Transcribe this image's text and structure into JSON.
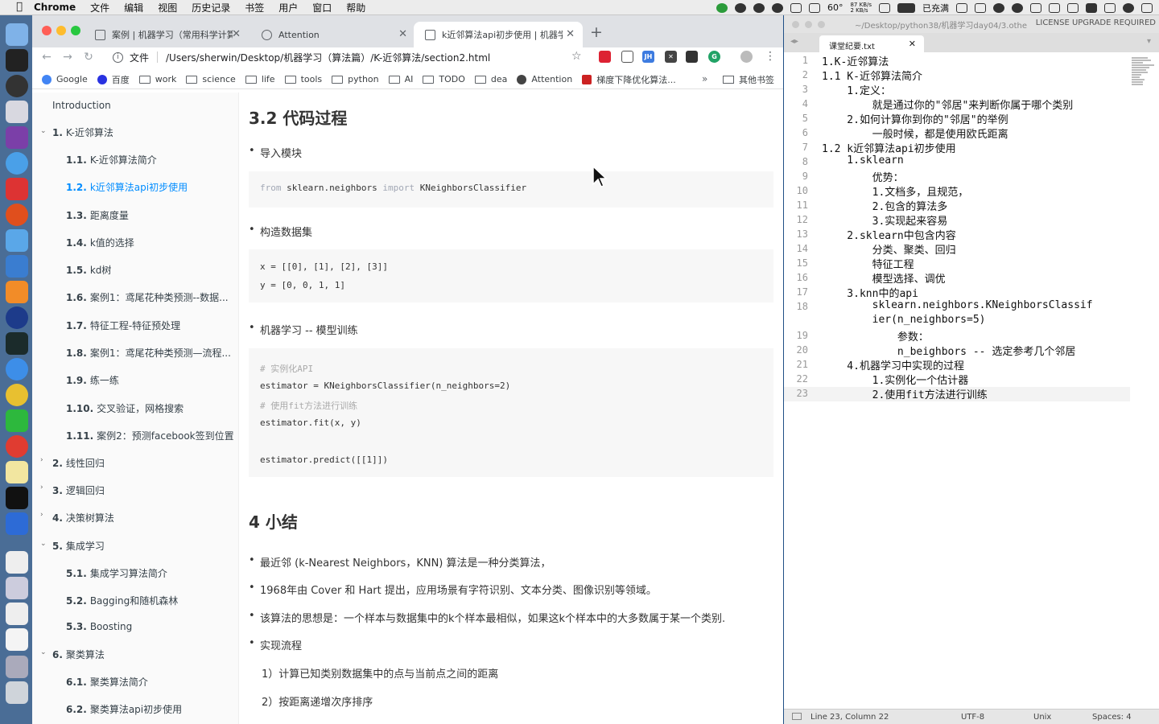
{
  "menubar": {
    "app": "Chrome",
    "items": [
      "文件",
      "编辑",
      "视图",
      "历史记录",
      "书签",
      "用户",
      "窗口",
      "帮助"
    ],
    "battery": "60°",
    "network": "87 KB/s\n2 KB/s",
    "charging": "已充满"
  },
  "chrome": {
    "tabs": [
      {
        "title": "案例 | 机器学习（常用科学计算",
        "active": false
      },
      {
        "title": "Attention",
        "active": false
      },
      {
        "title": "k近邻算法api初步使用 | 机器学",
        "active": true
      }
    ],
    "omnibox": {
      "scheme": "文件",
      "url": "/Users/sherwin/Desktop/机器学习（算法篇）/K-近邻算法/section2.html"
    },
    "bookmarks": [
      "Google",
      "百度",
      "work",
      "science",
      "life",
      "tools",
      "python",
      "AI",
      "TODO",
      "dea",
      "Attention",
      "梯度下降优化算法..."
    ],
    "bookmarks_more": "»",
    "bookmarks_other": "其他书签"
  },
  "sidebar": {
    "intro": "Introduction",
    "items": [
      {
        "num": "1.",
        "label": "K-近邻算法",
        "level": 1
      },
      {
        "num": "1.1.",
        "label": "K-近邻算法简介",
        "level": 2
      },
      {
        "num": "1.2.",
        "label": "k近邻算法api初步使用",
        "level": 2,
        "active": true
      },
      {
        "num": "1.3.",
        "label": "距离度量",
        "level": 2
      },
      {
        "num": "1.4.",
        "label": "k值的选择",
        "level": 2
      },
      {
        "num": "1.5.",
        "label": "kd树",
        "level": 2
      },
      {
        "num": "1.6.",
        "label": "案例1：鸢尾花种类预测--数据...",
        "level": 2
      },
      {
        "num": "1.7.",
        "label": "特征工程-特征预处理",
        "level": 2
      },
      {
        "num": "1.8.",
        "label": "案例1：鸢尾花种类预测—流程...",
        "level": 2
      },
      {
        "num": "1.9.",
        "label": "练一练",
        "level": 2
      },
      {
        "num": "1.10.",
        "label": "交叉验证，网格搜索",
        "level": 2
      },
      {
        "num": "1.11.",
        "label": "案例2：预测facebook签到位置",
        "level": 2
      },
      {
        "num": "2.",
        "label": "线性回归",
        "level": 1
      },
      {
        "num": "3.",
        "label": "逻辑回归",
        "level": 1
      },
      {
        "num": "4.",
        "label": "决策树算法",
        "level": 1
      },
      {
        "num": "5.",
        "label": "集成学习",
        "level": 1
      },
      {
        "num": "5.1.",
        "label": "集成学习算法简介",
        "level": 2
      },
      {
        "num": "5.2.",
        "label": "Bagging和随机森林",
        "level": 2
      },
      {
        "num": "5.3.",
        "label": "Boosting",
        "level": 2
      },
      {
        "num": "6.",
        "label": "聚类算法",
        "level": 1
      },
      {
        "num": "6.1.",
        "label": "聚类算法简介",
        "level": 2
      },
      {
        "num": "6.2.",
        "label": "聚类算法api初步使用",
        "level": 2
      }
    ]
  },
  "content": {
    "h_code": "3.2 代码过程",
    "b1": "导入模块",
    "code1_from": "from",
    "code1_mod": " sklearn.neighbors ",
    "code1_import": "import",
    "code1_cls": " KNeighborsClassifier",
    "b2": "构造数据集",
    "code2_l1": "x = [[0], [1], [2], [3]]",
    "code2_l2": "y = [0, 0, 1, 1]",
    "b3": "机器学习 -- 模型训练",
    "code3_c1": "# 实例化API",
    "code3_l2": "estimator = KNeighborsClassifier(n_neighbors=2)",
    "code3_c2": "# 使用fit方法进行训练",
    "code3_l4": "estimator.fit(x, y)",
    "code3_l6": "estimator.predict([[1]])",
    "h_summary": "4 小结",
    "s1": "最近邻 (k-Nearest Neighbors，KNN) 算法是一种分类算法，",
    "s2": "1968年由 Cover 和 Hart 提出，应用场景有字符识别、文本分类、图像识别等领域。",
    "s3": "该算法的思想是：一个样本与数据集中的k个样本最相似，如果这k个样本中的大多数属于某一个类别.",
    "s4": "实现流程",
    "p1": "1）计算已知类别数据集中的点与当前点之间的距离",
    "p2": "2）按距离递增次序排序"
  },
  "editor": {
    "path": "~/Desktop/python38/机器学习day04/3.othe",
    "license": "LICENSE UPGRADE REQUIRED",
    "tab": "课堂纪要.txt",
    "lines": [
      "1.K-近邻算法",
      "1.1 K-近邻算法简介",
      "    1.定义：",
      "        就是通过你的\"邻居\"来判断你属于哪个类别",
      "    2.如何计算你到你的\"邻居\"的举例",
      "        一般时候，都是使用欧氏距离",
      "1.2 k近邻算法api初步使用",
      "    1.sklearn",
      "        优势：",
      "        1.文档多，且规范，",
      "        2.包含的算法多",
      "        3.实现起来容易",
      "    2.sklearn中包含内容",
      "        分类、聚类、回归",
      "        特征工程",
      "        模型选择、调优",
      "    3.knn中的api",
      "        sklearn.neighbors.KNeighborsClassif",
      "        ier(n_neighbors=5)",
      "            参数：",
      "            n_beighbors -- 选定参考几个邻居",
      "    4.机器学习中实现的过程",
      "        1.实例化一个估计器",
      "        2.使用fit方法进行训练"
    ],
    "gutter": [
      "1",
      "2",
      "3",
      "4",
      "5",
      "6",
      "7",
      "8",
      "9",
      "10",
      "11",
      "12",
      "13",
      "14",
      "15",
      "16",
      "17",
      "18",
      "",
      "19",
      "20",
      "21",
      "22",
      "23"
    ],
    "status": {
      "pos": "Line 23, Column 22",
      "enc": "UTF-8",
      "eol": "Unix",
      "indent": "Spaces: 4"
    }
  }
}
